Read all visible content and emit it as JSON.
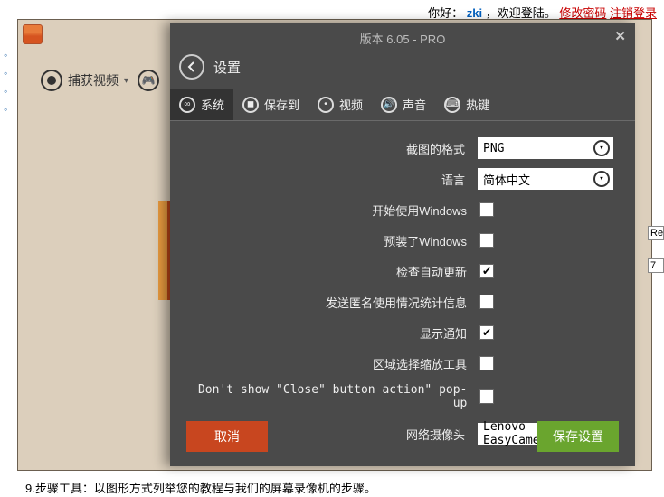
{
  "top_status": {
    "hello": "你好：",
    "user": "zki",
    "welcome": "，欢迎登陆。",
    "mod_pwd": "修改密码",
    "logout": "注销登录"
  },
  "toolbar": {
    "capture_label": "捕获视频"
  },
  "modal": {
    "version": "版本 6.05 - PRO",
    "title": "设置",
    "tabs": {
      "system": "系统",
      "save_to": "保存到",
      "video": "视频",
      "audio": "声音",
      "hotkeys": "热键"
    },
    "labels": {
      "screenshot_format": "截图的格式",
      "language": "语言",
      "start_with_win": "开始使用Windows",
      "preinstalled_win": "预装了Windows",
      "check_updates": "检查自动更新",
      "send_anon_stats": "发送匿名使用情况统计信息",
      "show_notifications": "显示通知",
      "region_zoom_tool": "区域选择缩放工具",
      "dont_show_close": "Don't show \"Close\" button action\" pop-up",
      "webcam": "网络摄像头"
    },
    "values": {
      "screenshot_format": "PNG",
      "language": "简体中文",
      "start_with_win": false,
      "preinstalled_win": false,
      "check_updates": true,
      "send_anon_stats": false,
      "show_notifications": true,
      "region_zoom_tool": false,
      "dont_show_close": false,
      "webcam": "Lenovo EasyCamer"
    },
    "buttons": {
      "cancel": "取消",
      "save": "保存设置"
    }
  },
  "bottom_text": "9.步骤工具：以图形方式列举您的教程与我们的屏幕录像机的步骤。",
  "sliver": {
    "a": "Re",
    "b": "7"
  }
}
